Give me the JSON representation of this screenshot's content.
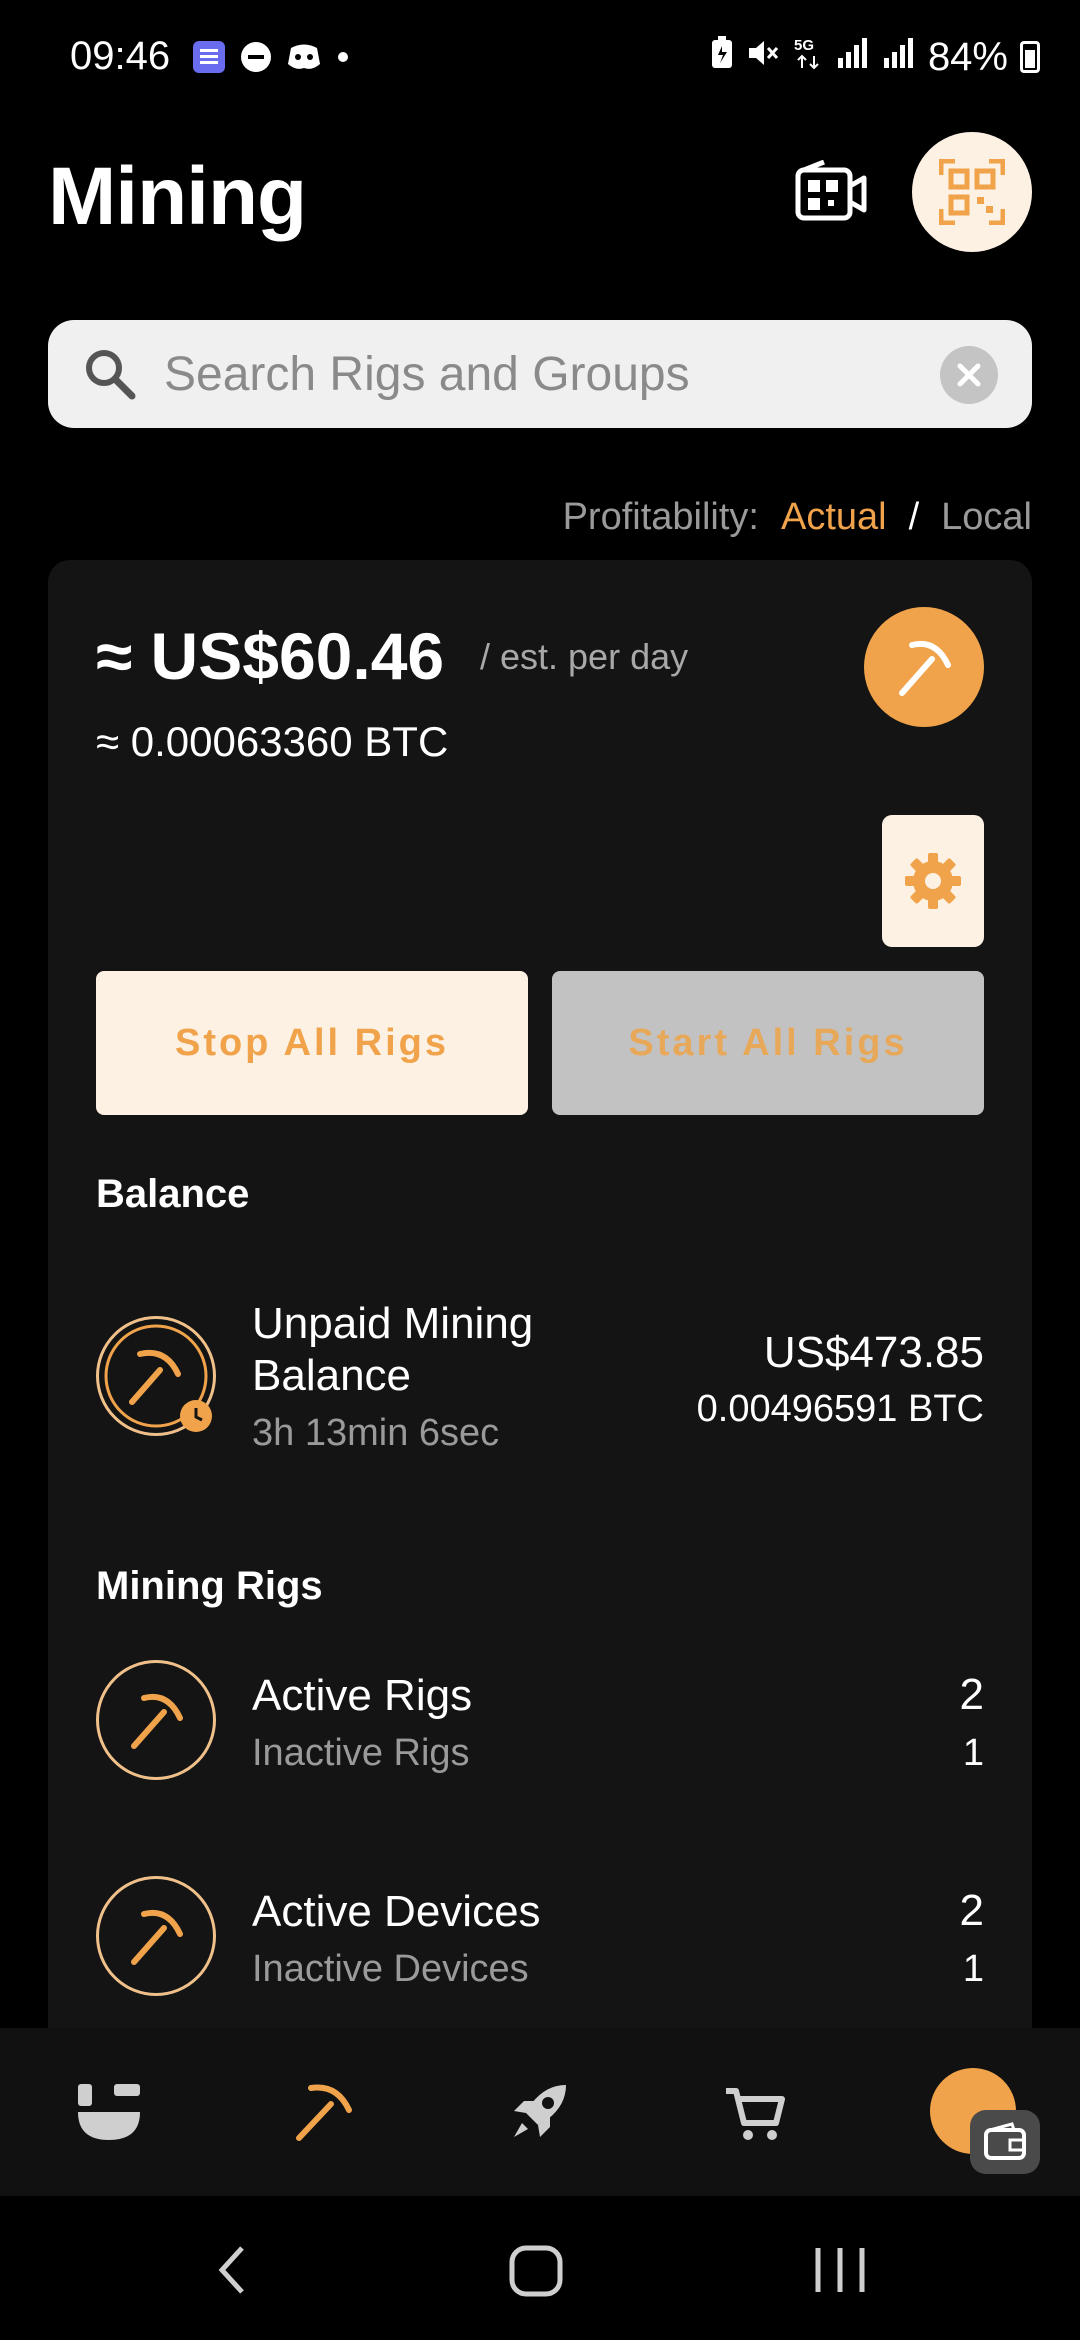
{
  "status_bar": {
    "time": "09:46",
    "battery": "84%",
    "icons_left": [
      "list-app-icon",
      "do-not-disturb-icon",
      "discord-icon",
      "dot-icon"
    ],
    "icons_right": [
      "battery-saver-icon",
      "mute-icon",
      "5g-icon",
      "signal-icon",
      "signal-icon-2",
      "battery-icon"
    ]
  },
  "header": {
    "title": "Mining"
  },
  "search": {
    "placeholder": "Search Rigs and Groups"
  },
  "profitability": {
    "label": "Profitability:",
    "actual": "Actual",
    "separator": "/",
    "local": "Local"
  },
  "summary": {
    "usd": "≈ US$60.46",
    "per_day": "/ est. per day",
    "btc": "≈ 0.00063360 BTC"
  },
  "actions": {
    "stop_all": "Stop All Rigs",
    "start_all": "Start All Rigs"
  },
  "balance": {
    "section_title": "Balance",
    "title": "Unpaid Mining Balance",
    "timer": "3h 13min 6sec",
    "usd": "US$473.85",
    "btc": "0.00496591 BTC"
  },
  "rigs": {
    "section_title": "Mining Rigs",
    "items": [
      {
        "title": "Active Rigs",
        "sub": "Inactive Rigs",
        "value": "2",
        "sub_value": "1"
      },
      {
        "title": "Active Devices",
        "sub": "Inactive Devices",
        "value": "2",
        "sub_value": "1"
      }
    ]
  },
  "colors": {
    "accent": "#f0a34a",
    "cream": "#fdf1e4",
    "card": "#141414"
  }
}
